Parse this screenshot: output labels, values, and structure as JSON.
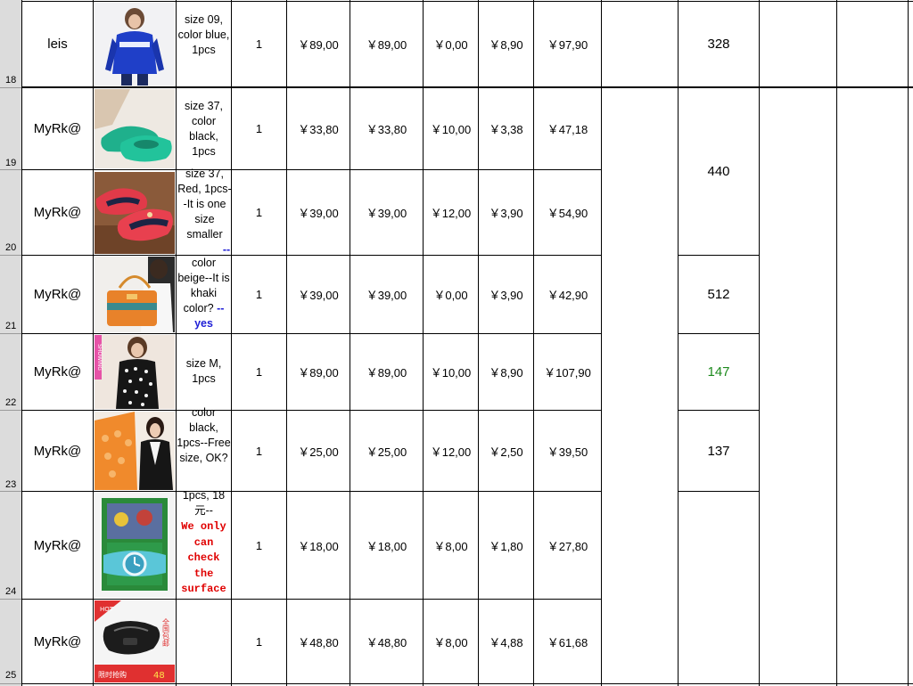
{
  "rows": [
    {
      "num": "18",
      "buyer": "leis",
      "desc": "size 09, color blue, 1pcs",
      "note": "",
      "qty": "1",
      "price": "￥89,00",
      "subtotal": "￥89,00",
      "shipping": "￥0,00",
      "fee": "￥8,90",
      "total": "￥97,90",
      "order": "328",
      "order_color": "#000000"
    },
    {
      "num": "19",
      "buyer": "MyRk@",
      "desc": "size 37, color black, 1pcs",
      "note": "",
      "qty": "1",
      "price": "￥33,80",
      "subtotal": "￥33,80",
      "shipping": "￥10,00",
      "fee": "￥3,38",
      "total": "￥47,18",
      "order": "440",
      "order_color": "#000000"
    },
    {
      "num": "20",
      "buyer": "MyRk@",
      "desc": "size 37, Red, 1pcs--It is one size smaller",
      "note": "--",
      "qty": "1",
      "price": "￥39,00",
      "subtotal": "￥39,00",
      "shipping": "￥12,00",
      "fee": "￥3,90",
      "total": "￥54,90",
      "order": "",
      "order_color": "#000000"
    },
    {
      "num": "21",
      "buyer": "MyRk@",
      "desc": "color beige--It is khaki color?",
      "note": "--yes",
      "qty": "1",
      "price": "￥39,00",
      "subtotal": "￥39,00",
      "shipping": "￥0,00",
      "fee": "￥3,90",
      "total": "￥42,90",
      "order": "512",
      "order_color": "#000000"
    },
    {
      "num": "22",
      "buyer": "MyRk@",
      "desc": "size M, 1pcs",
      "note": "",
      "qty": "1",
      "price": "￥89,00",
      "subtotal": "￥89,00",
      "shipping": "￥10,00",
      "fee": "￥8,90",
      "total": "￥107,90",
      "order": "147",
      "order_color": "#1d8a1d"
    },
    {
      "num": "23",
      "buyer": "MyRk@",
      "desc": "color black, 1pcs--Free size, OK?",
      "note": "",
      "qty": "1",
      "price": "￥25,00",
      "subtotal": "￥25,00",
      "shipping": "￥12,00",
      "fee": "￥2,50",
      "total": "￥39,50",
      "order": "137",
      "order_color": "#000000"
    },
    {
      "num": "24",
      "buyer": "MyRk@",
      "desc": "1pcs, 18元--",
      "note": "We only can check the surface the",
      "qty": "1",
      "price": "￥18,00",
      "subtotal": "￥18,00",
      "shipping": "￥8,00",
      "fee": "￥1,80",
      "total": "￥27,80",
      "order": "",
      "order_color": "#000000"
    },
    {
      "num": "25",
      "buyer": "MyRk@",
      "desc": "",
      "note": "",
      "qty": "1",
      "price": "￥48,80",
      "subtotal": "￥48,80",
      "shipping": "￥8,00",
      "fee": "￥4,88",
      "total": "￥61,68",
      "order": "",
      "order_color": "#000000"
    }
  ],
  "thumb_text": {
    "row22_tag": "SHOWING",
    "row25_top": "HOT",
    "row25_side": "全国包邮",
    "row25_price": "48",
    "row25_label": "限时抢购"
  }
}
